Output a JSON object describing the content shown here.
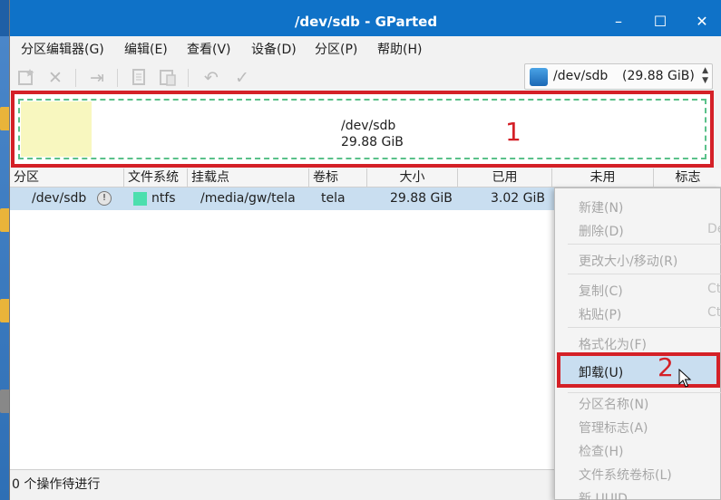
{
  "window": {
    "title": "/dev/sdb - GParted",
    "minimize_glyph": "–",
    "maximize_glyph": "☐",
    "close_glyph": "✕"
  },
  "menubar": [
    "分区编辑器(G)",
    "编辑(E)",
    "查看(V)",
    "设备(D)",
    "分区(P)",
    "帮助(H)"
  ],
  "toolbar": {
    "icons": [
      "new-partition-icon",
      "delete-icon",
      "resize-icon",
      "copy-icon",
      "paste-icon",
      "undo-icon",
      "apply-icon"
    ],
    "device": {
      "name": "/dev/sdb",
      "size": "(29.88 GiB)"
    }
  },
  "graph": {
    "path": "/dev/sdb",
    "size": "29.88 GiB"
  },
  "annotations": {
    "one": "1",
    "two": "2"
  },
  "table": {
    "headers": [
      "分区",
      "文件系统",
      "挂载点",
      "卷标",
      "大小",
      "已用",
      "未用",
      "标志"
    ],
    "rows": [
      {
        "partition": "/dev/sdb",
        "fs": "ntfs",
        "mount": "/media/gw/tela",
        "label": "tela",
        "size": "29.88 GiB",
        "used": "3.02 GiB"
      }
    ]
  },
  "status": "0 个操作待进行",
  "context_menu": {
    "items": [
      {
        "label": "新建(N)",
        "shortcut": ""
      },
      {
        "label": "删除(D)",
        "shortcut": "De"
      },
      {
        "label": "更改大小/移动(R)",
        "shortcut": ""
      },
      {
        "label": "复制(C)",
        "shortcut": "Ct"
      },
      {
        "label": "粘贴(P)",
        "shortcut": "Ct"
      },
      {
        "label": "格式化为(F)",
        "shortcut": ""
      },
      {
        "label": "卸载(U)",
        "shortcut": ""
      },
      {
        "label": "分区名称(N)",
        "shortcut": ""
      },
      {
        "label": "管理标志(A)",
        "shortcut": ""
      },
      {
        "label": "检查(H)",
        "shortcut": ""
      },
      {
        "label": "文件系统卷标(L)",
        "shortcut": ""
      },
      {
        "label": "新 UUID",
        "shortcut": ""
      }
    ]
  },
  "colors": {
    "titlebar": "#0f72c8",
    "highlight_frame": "#d42027",
    "ntfs": "#4cdfae",
    "selection": "#c9def0"
  }
}
